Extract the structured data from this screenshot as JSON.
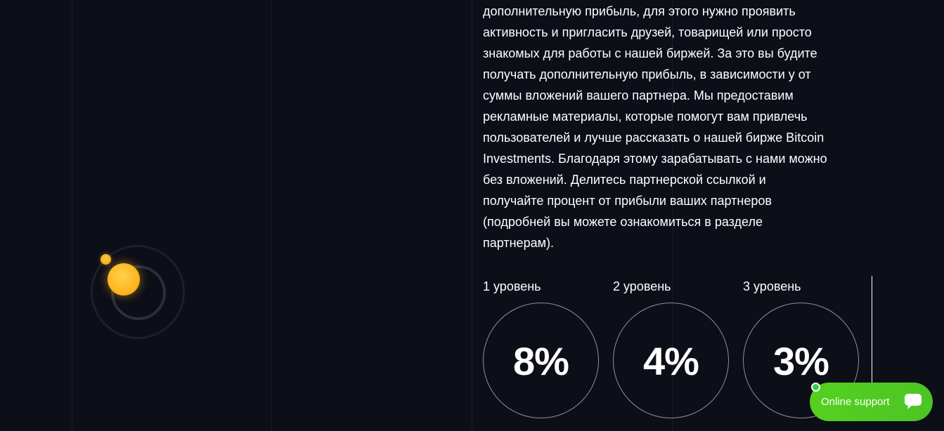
{
  "description": "дополнительную прибыль, для этого нужно проявить\nактивность и пригласить друзей, товарищей или просто\nзнакомых для работы с нашей биржей. За это вы будите\nполучать дополнительную прибыль, в зависимости у от\nсуммы вложений вашего партнера. Мы предоставим\nрекламные материалы, которые помогут вам привлечь\nпользователей и лучше рассказать о нашей бирже Bitcoin\nInvestments. Благодаря этому зарабатывать с нами можно\nбез вложений. Делитесь партнерской ссылкой и\nполучайте процент от прибыли ваших партнеров\n(подробней вы можете ознакомиться в разделе\nпартнерам).",
  "levels": [
    {
      "label": "1 уровень",
      "value": "8%"
    },
    {
      "label": "2 уровень",
      "value": "4%"
    },
    {
      "label": "3 уровень",
      "value": "3%"
    }
  ],
  "support": {
    "label": "Online support",
    "icon": "chat-bubble-icon",
    "status": "online"
  },
  "colors": {
    "background": "#0c0e18",
    "accent_green": "#55d020",
    "sun": "#ffb51f"
  }
}
